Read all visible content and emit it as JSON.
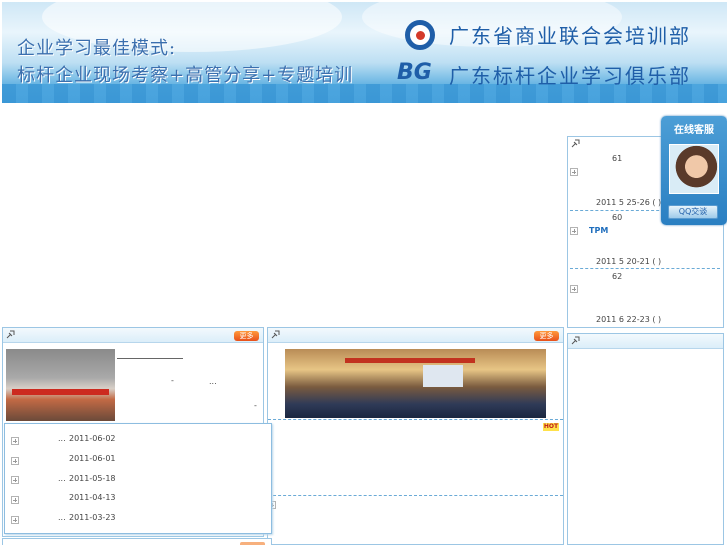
{
  "banner": {
    "slogan_line1": "企业学习最佳模式:",
    "slogan_line2": "标杆企业现场考察+高管分享+专题培训",
    "org_line1": "广东省商业联合会培训部",
    "org_line2": "广东标杆企业学习俱乐部",
    "logo_text": "BG"
  },
  "online_service": {
    "title": "在线客服",
    "button": "QQ交谈"
  },
  "right_top_list": [
    {
      "number": "61",
      "tag": "",
      "date": "2011 5 25-26 ( )"
    },
    {
      "number": "60",
      "tag": "TPM",
      "date": "2011 5 20-21 ( )"
    },
    {
      "number": "62",
      "tag": "",
      "date": "2011 6 22-23 ( )"
    }
  ],
  "left_panel": {
    "more_label": "更多",
    "dots": [
      "-",
      "...",
      "-"
    ]
  },
  "middle_panel": {
    "more_label": "更多",
    "hot_label": "HOT"
  },
  "date_list": [
    {
      "prefix": "...",
      "date": "2011-06-02"
    },
    {
      "prefix": "",
      "date": "2011-06-01"
    },
    {
      "prefix": "...",
      "date": "2011-05-18"
    },
    {
      "prefix": "",
      "date": "2011-04-13"
    },
    {
      "prefix": "...",
      "date": "2011-03-23"
    }
  ],
  "colors": {
    "brand_blue": "#1f5ea8",
    "panel_border": "#9cc6e4",
    "more_button": "#e8501a",
    "hot_badge": "#ffe14a"
  }
}
